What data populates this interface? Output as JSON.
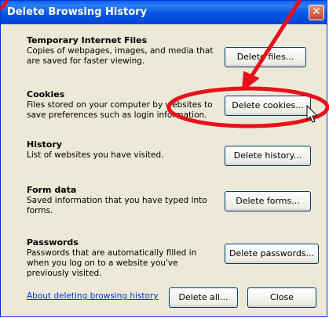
{
  "window": {
    "title": "Delete Browsing History",
    "close_glyph": "✕"
  },
  "sections": [
    {
      "heading": "Temporary Internet Files",
      "desc": "Copies of webpages, images, and media that are saved for faster viewing.",
      "button": "Delete files..."
    },
    {
      "heading": "Cookies",
      "desc": "Files stored on your computer by websites to save preferences such as login information.",
      "button": "Delete cookies..."
    },
    {
      "heading": "History",
      "desc": "List of websites you have visited.",
      "button": "Delete history..."
    },
    {
      "heading": "Form data",
      "desc": "Saved information that you have typed into forms.",
      "button": "Delete forms..."
    },
    {
      "heading": "Passwords",
      "desc": "Passwords that are automatically filled in when you log on to a website you've previously visited.",
      "button": "Delete passwords..."
    }
  ],
  "footer": {
    "link": "About deleting browsing history",
    "delete_all": "Delete all...",
    "close": "Close"
  },
  "annotation": {
    "color": "#e8101a"
  }
}
